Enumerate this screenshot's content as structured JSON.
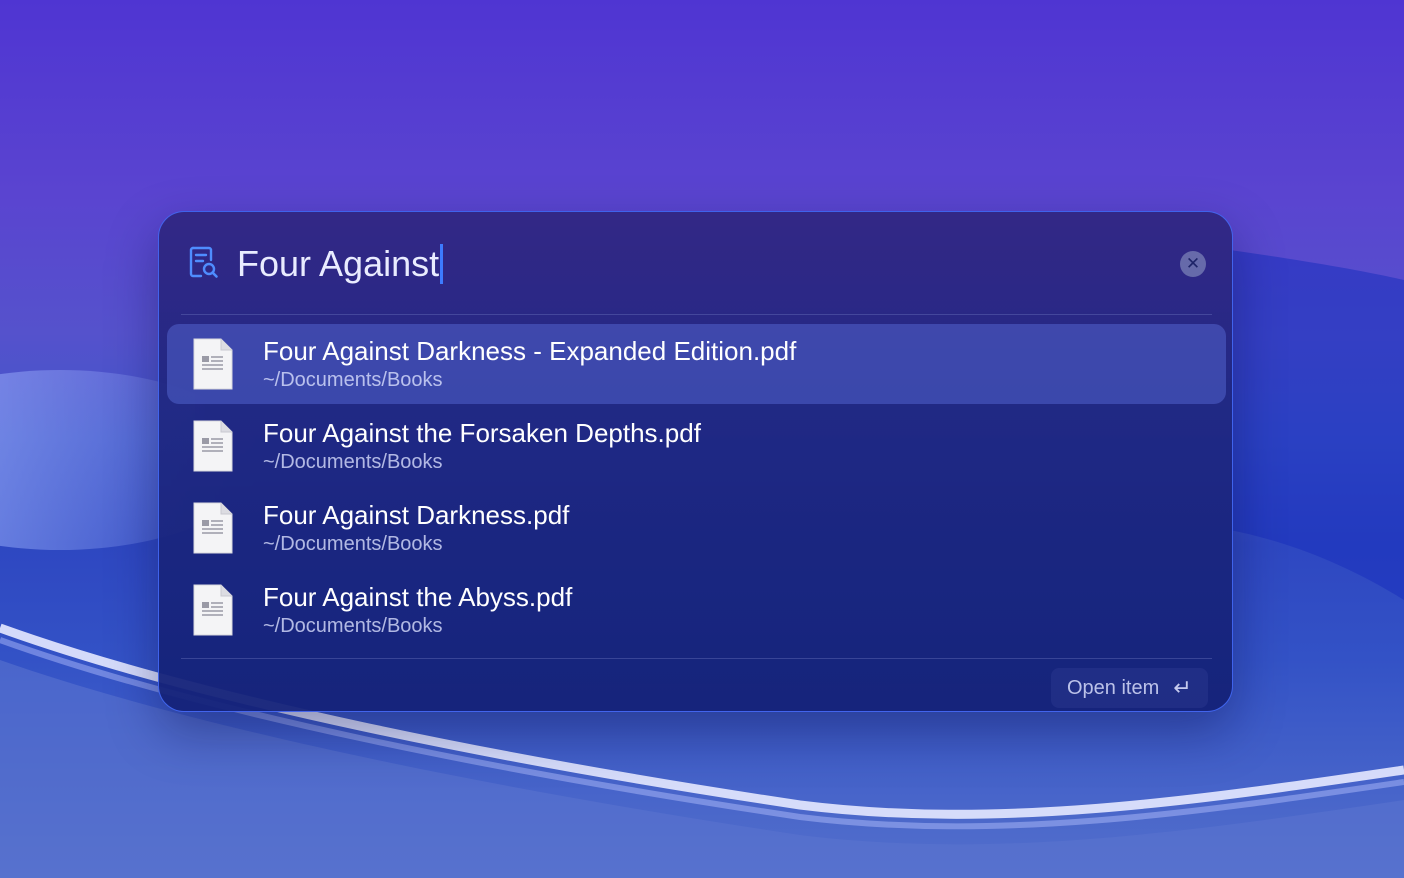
{
  "search": {
    "query": "Four Against",
    "clear_icon": "close-circle-icon",
    "leading_icon": "document-search-icon"
  },
  "results": [
    {
      "title": "Four Against Darkness - Expanded Edition.pdf",
      "path": "~/Documents/Books",
      "selected": true
    },
    {
      "title": "Four Against the Forsaken Depths.pdf",
      "path": "~/Documents/Books",
      "selected": false
    },
    {
      "title": "Four Against Darkness.pdf",
      "path": "~/Documents/Books",
      "selected": false
    },
    {
      "title": "Four Against the Abyss.pdf",
      "path": "~/Documents/Books",
      "selected": false
    }
  ],
  "footer": {
    "action_label": "Open item",
    "action_icon": "return-key-icon"
  },
  "colors": {
    "accent": "#3d7bff",
    "panel_border": "#466eff",
    "text_primary": "#ffffff"
  }
}
